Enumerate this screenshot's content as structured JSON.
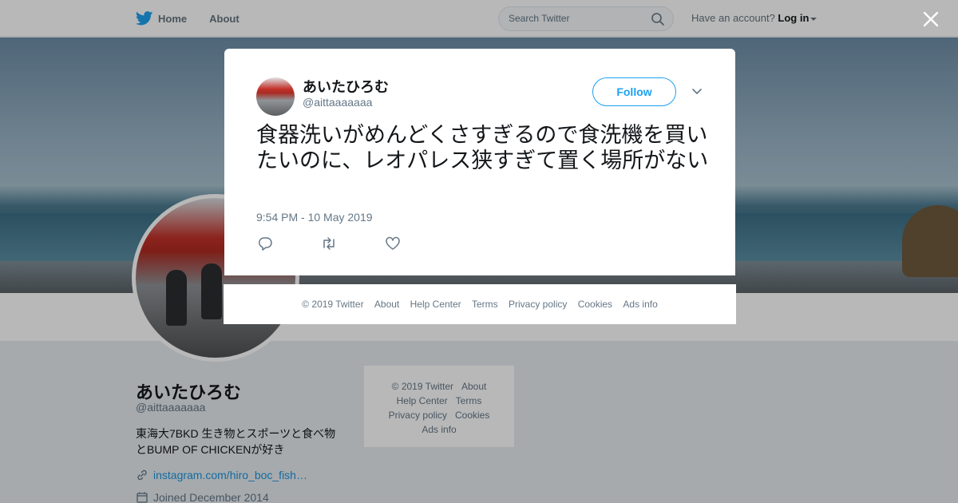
{
  "nav": {
    "home_label": "Home",
    "about_label": "About",
    "search_placeholder": "Search Twitter",
    "account_prompt": "Have an account?",
    "login_label": "Log in"
  },
  "profile": {
    "name": "あいたひろむ",
    "handle": "@aittaaaaaaa",
    "bio": "東海大7BKD 生き物とスポーツと食べ物とBUMP OF CHICKENが好き",
    "link": "instagram.com/hiro_boc_fish…",
    "joined": "Joined December 2014"
  },
  "side_footer": {
    "items": [
      "© 2019 Twitter",
      "About",
      "Help Center",
      "Terms",
      "Privacy policy",
      "Cookies",
      "Ads info"
    ]
  },
  "tweet": {
    "author_name": "あいたひろむ",
    "author_handle": "@aittaaaaaaa",
    "follow_label": "Follow",
    "text": "食器洗いがめんどくさすぎるので食洗機を買いたいのに、レオパレス狭すぎて置く場所がない",
    "timestamp": "9:54 PM - 10 May 2019"
  },
  "modal_footer": {
    "items": [
      "© 2019 Twitter",
      "About",
      "Help Center",
      "Terms",
      "Privacy policy",
      "Cookies",
      "Ads info"
    ]
  },
  "icons": {
    "brand": "twitter-bird-icon",
    "home": "home-icon",
    "search": "search-icon",
    "close": "close-icon",
    "more": "chevron-down-icon",
    "reply": "reply-icon",
    "retweet": "retweet-icon",
    "like": "heart-icon",
    "link": "link-icon",
    "calendar": "calendar-icon"
  },
  "colors": {
    "accent": "#1da1f2",
    "link": "#1b95e0",
    "muted": "#657786"
  }
}
